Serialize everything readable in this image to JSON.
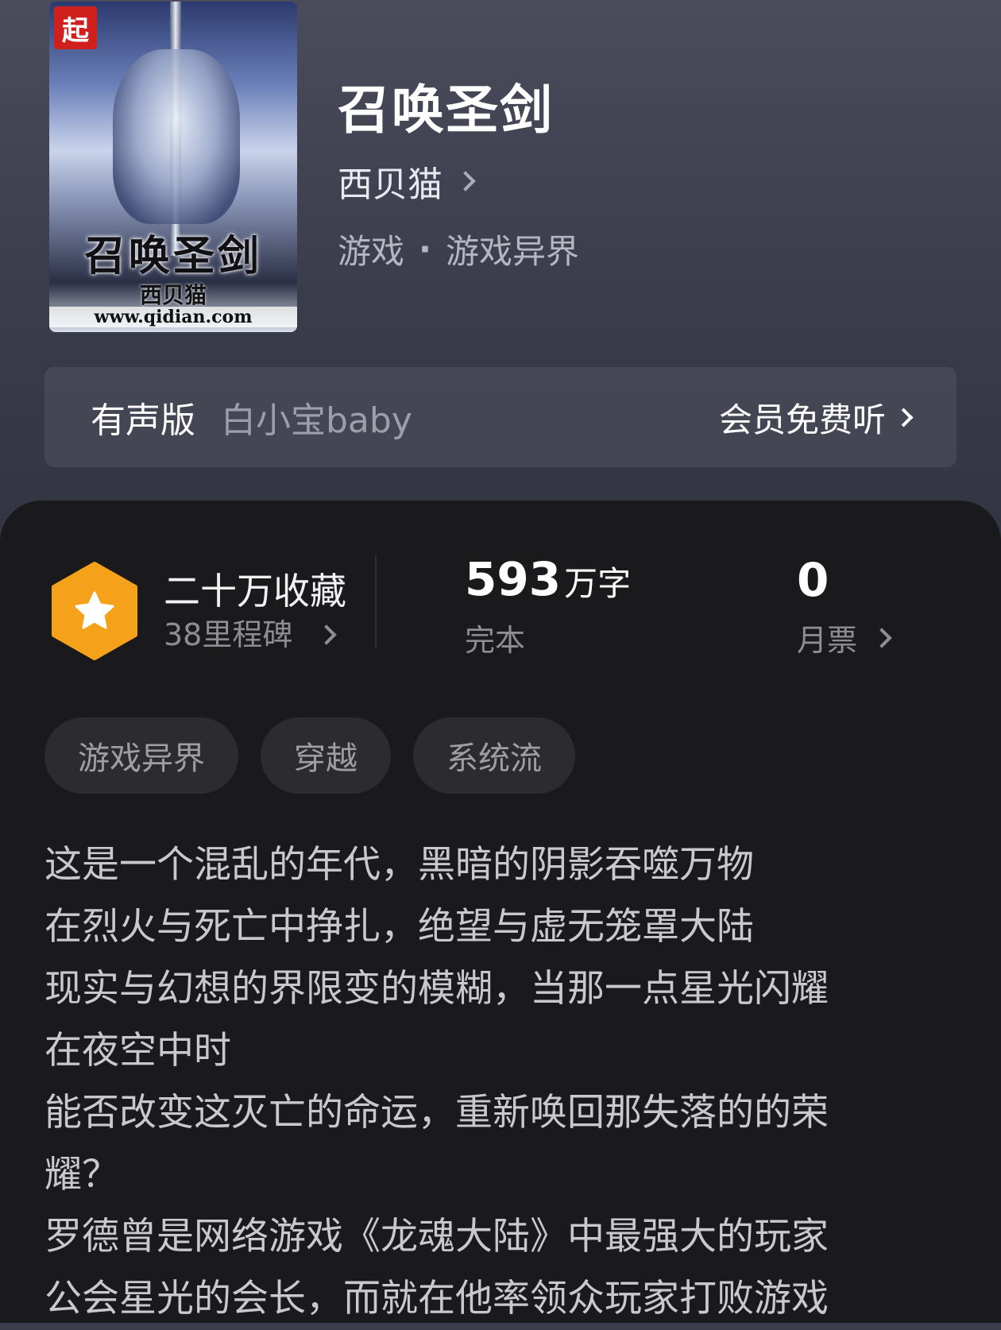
{
  "book": {
    "title": "召唤圣剑",
    "author": "西贝猫",
    "category": "游戏",
    "subcategory": "游戏异界"
  },
  "cover": {
    "badge": "起",
    "title": "召唤圣剑",
    "author": "西贝猫",
    "url": "www.qidian.com"
  },
  "audio": {
    "label": "有声版",
    "narrator": "白小宝baby",
    "cta": "会员免费听"
  },
  "stats": {
    "favorites": "二十万收藏",
    "milestones": "38里程碑",
    "word_count": "593",
    "word_unit": "万字",
    "status": "完本",
    "monthly_tickets": "0",
    "monthly_tickets_label": "月票"
  },
  "tags": [
    "游戏异界",
    "穿越",
    "系统流"
  ],
  "intro_lines": [
    "这是一个混乱的年代，黑暗的阴影吞噬万物",
    "在烈火与死亡中挣扎，绝望与虚无笼罩大陆",
    "现实与幻想的界限变的模糊，当那一点星光闪耀",
    "在夜空中时",
    "能否改变这灭亡的命运，重新唤回那失落的的荣",
    "耀？",
    "罗德曾是网络游戏《龙魂大陆》中最强大的玩家",
    "公会星光的会长，而就在他率领众玩家打败游戏"
  ],
  "icons": {
    "favorites_badge": "star-hexagon-icon",
    "chevron": "chevron-right-icon"
  },
  "colors": {
    "accent_orange": "#f7a21b",
    "panel_bg": "#1a1a1c",
    "header_bg": "#3b3d4c"
  }
}
